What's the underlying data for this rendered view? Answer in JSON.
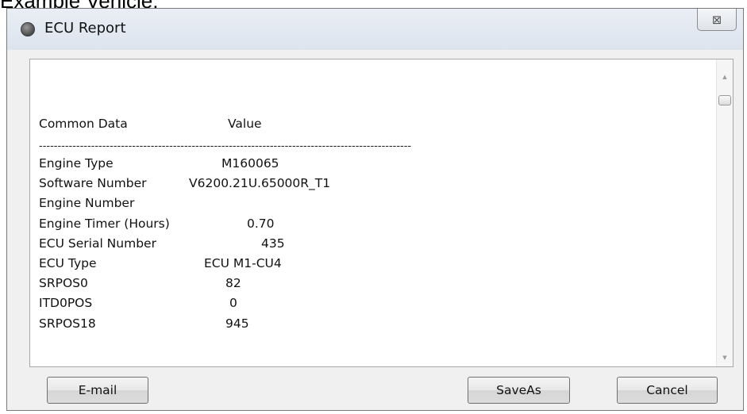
{
  "page_caption": "Example Vehicle:",
  "window": {
    "title": "ECU Report",
    "close_glyph": "⊠"
  },
  "report": {
    "header_key": "Common Data",
    "header_value": "Value",
    "separator": "----------------------------------------------------------------------------------------------------",
    "rows": [
      {
        "key": "Engine Type",
        "value": "M160065"
      },
      {
        "key": "Software Number",
        "value": "V6200.21U.65000R_T1"
      },
      {
        "key": "Engine Number",
        "value": ""
      },
      {
        "key": "Engine Timer (Hours)",
        "value": "0.70"
      },
      {
        "key": "ECU Serial Number",
        "value": "435"
      },
      {
        "key": "ECU Type",
        "value": "ECU M1-CU4"
      },
      {
        "key": "SRPOS0",
        "value": "82"
      },
      {
        "key": "ITD0POS",
        "value": "0"
      },
      {
        "key": "SRPOS18",
        "value": "945"
      }
    ]
  },
  "scrollbar": {
    "up_glyph": "▲",
    "down_glyph": "▼"
  },
  "buttons": {
    "email": "E-mail",
    "saveas": "SaveAs",
    "cancel": "Cancel"
  }
}
